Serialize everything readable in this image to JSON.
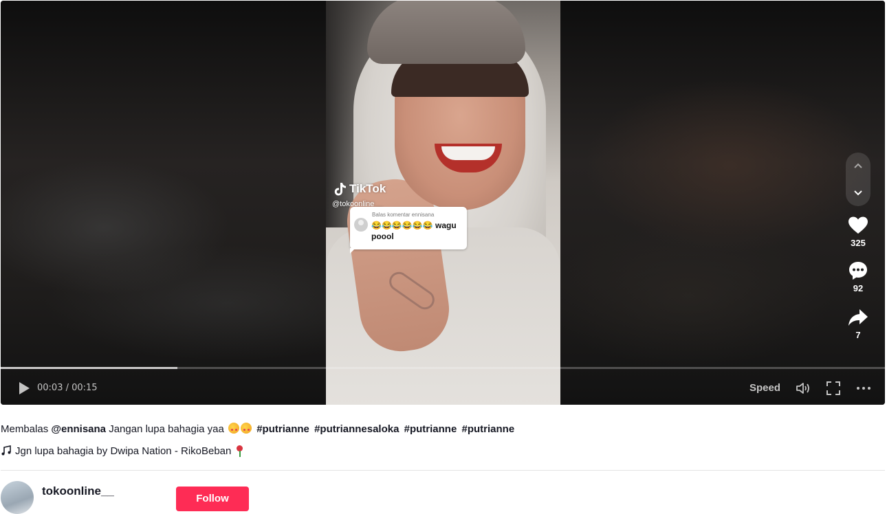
{
  "video": {
    "watermark_brand": "TikTok",
    "watermark_handle": "@tokoonline__",
    "reply_bubble": {
      "label": "Balas komentar ennisana",
      "text": "😂😂😂😂😂😂 wagu poool"
    },
    "progress_fraction": 0.2,
    "time_display": "00:03 / 00:15",
    "speed_label": "Speed"
  },
  "actions": {
    "likes": "325",
    "comments": "92",
    "shares": "7"
  },
  "description": {
    "prefix": "Membalas",
    "mention": "@ennisana",
    "text": "Jangan lupa bahagia yaa",
    "hashtags": [
      "#putrianne",
      "#putriannesaloka",
      "#putrianne",
      "#putrianne"
    ]
  },
  "music": {
    "text": "Jgn lupa bahagia by Dwipa Nation - RikoBeban"
  },
  "author": {
    "username": "tokoonline__",
    "follow_label": "Follow"
  },
  "colors": {
    "accent": "#fe2c55",
    "text": "#161823"
  },
  "icons": [
    "play-icon",
    "volume-icon",
    "fullscreen-icon",
    "more-icon",
    "chevron-up-icon",
    "chevron-down-icon",
    "heart-icon",
    "comment-icon",
    "share-icon",
    "music-note-icon",
    "tiktok-logo-icon"
  ]
}
